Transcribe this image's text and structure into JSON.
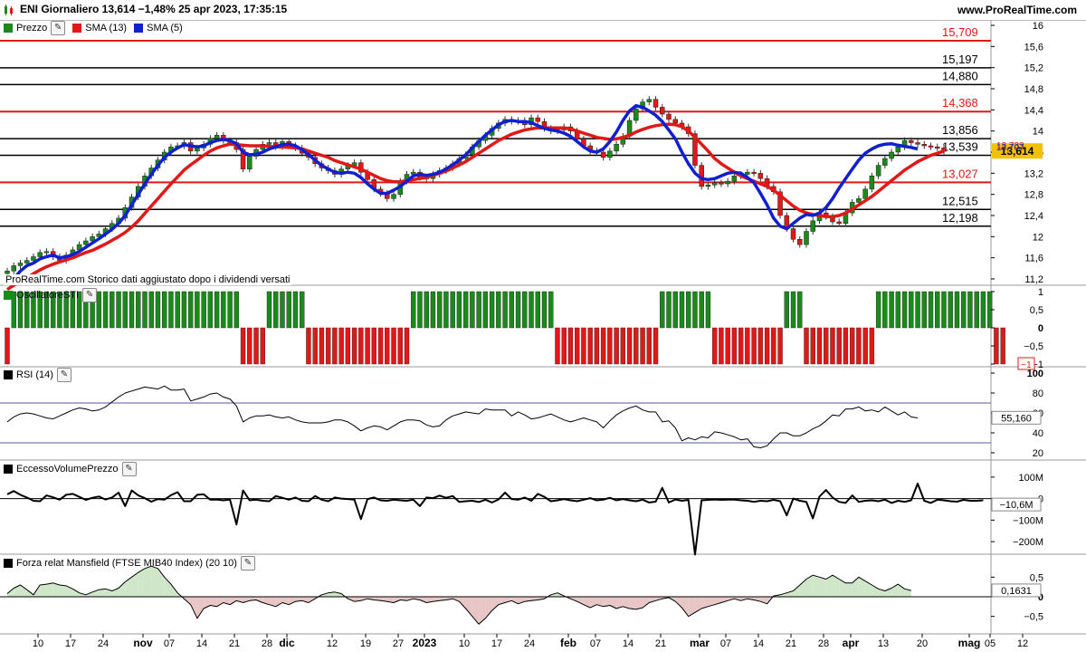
{
  "header": {
    "title": "ENI Giornaliero 13,614 −1,48% 25 apr 2023, 17:35:15",
    "brand": "www.ProRealTime.com"
  },
  "price_legend": {
    "price": "Prezzo",
    "sma13": "SMA (13)",
    "sma5": "SMA (5)"
  },
  "notice": "ProRealTime.com Storico dati aggiustato dopo i dividendi versati",
  "panels": {
    "sti": "OscillatoreSTI",
    "rsi": "RSI (14)",
    "volume": "EccessoVolumePrezzo",
    "mansfield": "Forza relat Mansfield (FTSE MIB40 Index) (20 10)"
  },
  "colors": {
    "up": "#1a8a1a",
    "down": "#e01818",
    "sma13": "#e01818",
    "sma5": "#1020d0",
    "price_tag": "#f2c200",
    "mans_pos": "#cfe6c8",
    "mans_neg": "#e8c6c6"
  },
  "chart_data": [
    {
      "type": "candlestick",
      "title": "ENI Giornaliero",
      "ylim": [
        11.2,
        16.0
      ],
      "yticks": [
        "16",
        "15,6",
        "15,2",
        "14,8",
        "14,4",
        "14",
        "13,6",
        "13,2",
        "12,8",
        "12,4",
        "12",
        "11,6",
        "11,2"
      ],
      "x_labels": [
        "10",
        "17",
        "24",
        "nov",
        "07",
        "14",
        "21",
        "28",
        "dic",
        "12",
        "19",
        "27",
        "2023",
        "10",
        "17",
        "24",
        "feb",
        "07",
        "14",
        "21",
        "mar",
        "07",
        "14",
        "21",
        "28",
        "apr",
        "13",
        "20",
        "mag",
        "05",
        "12"
      ],
      "last_price": "13,614",
      "last_change": "−1,48%",
      "price_axis_tags": [
        "13,707",
        "13,733"
      ],
      "levels": [
        {
          "label": "15,709",
          "value": 15.709,
          "color": "#e01818"
        },
        {
          "label": "15,197",
          "value": 15.197,
          "color": "#000000"
        },
        {
          "label": "14,880",
          "value": 14.88,
          "color": "#000000"
        },
        {
          "label": "14,368",
          "value": 14.368,
          "color": "#e01818"
        },
        {
          "label": "13,856",
          "value": 13.856,
          "color": "#000000"
        },
        {
          "label": "13,539",
          "value": 13.539,
          "color": "#000000"
        },
        {
          "label": "13,027",
          "value": 13.027,
          "color": "#e01818"
        },
        {
          "label": "12,515",
          "value": 12.515,
          "color": "#000000"
        },
        {
          "label": "12,198",
          "value": 12.198,
          "color": "#000000"
        }
      ],
      "close": [
        11.35,
        11.45,
        11.5,
        11.55,
        11.62,
        11.7,
        11.72,
        11.62,
        11.55,
        11.65,
        11.75,
        11.85,
        11.92,
        12.0,
        12.05,
        12.15,
        12.25,
        12.35,
        12.55,
        12.75,
        12.95,
        13.15,
        13.3,
        13.45,
        13.6,
        13.7,
        13.72,
        13.78,
        13.62,
        13.68,
        13.75,
        13.86,
        13.92,
        13.82,
        13.78,
        13.65,
        13.28,
        13.52,
        13.65,
        13.75,
        13.78,
        13.7,
        13.8,
        13.72,
        13.68,
        13.58,
        13.5,
        13.38,
        13.3,
        13.25,
        13.18,
        13.28,
        13.35,
        13.4,
        13.22,
        13.08,
        12.9,
        12.82,
        12.72,
        12.8,
        13.05,
        13.18,
        13.22,
        13.12,
        13.1,
        13.18,
        13.25,
        13.3,
        13.38,
        13.48,
        13.55,
        13.7,
        13.82,
        13.92,
        14.05,
        14.15,
        14.22,
        14.18,
        14.2,
        14.12,
        14.25,
        14.18,
        14.05,
        14.0,
        14.02,
        14.08,
        14.0,
        13.85,
        13.72,
        13.62,
        13.6,
        13.5,
        13.62,
        13.75,
        13.9,
        14.2,
        14.42,
        14.55,
        14.6,
        14.45,
        14.32,
        14.22,
        14.15,
        14.08,
        13.95,
        13.35,
        12.95,
        12.98,
        13.02,
        13.0,
        13.05,
        13.15,
        13.18,
        13.22,
        13.2,
        13.1,
        12.95,
        12.85,
        12.4,
        12.15,
        11.95,
        11.85,
        12.1,
        12.3,
        12.45,
        12.38,
        12.28,
        12.25,
        12.45,
        12.65,
        12.72,
        12.9,
        13.15,
        13.35,
        13.48,
        13.6,
        13.7,
        13.82,
        13.78,
        13.75,
        13.72,
        13.7,
        13.68,
        13.614
      ],
      "sma13": [
        11.0,
        11.08,
        11.15,
        11.22,
        11.3,
        11.37,
        11.43,
        11.48,
        11.52,
        11.56,
        11.6,
        11.65,
        11.7,
        11.74,
        11.8,
        11.86,
        11.93,
        12.0,
        12.08,
        12.18,
        12.3,
        12.44,
        12.58,
        12.72,
        12.86,
        13.0,
        13.13,
        13.26,
        13.36,
        13.45,
        13.54,
        13.62,
        13.68,
        13.72,
        13.75,
        13.74,
        13.73,
        13.72,
        13.72,
        13.72,
        13.71,
        13.7,
        13.7,
        13.69,
        13.68,
        13.66,
        13.62,
        13.58,
        13.54,
        13.5,
        13.44,
        13.4,
        13.36,
        13.32,
        13.28,
        13.22,
        13.16,
        13.1,
        13.06,
        13.04,
        13.04,
        13.06,
        13.08,
        13.1,
        13.12,
        13.16,
        13.2,
        13.24,
        13.3,
        13.36,
        13.42,
        13.5,
        13.58,
        13.66,
        13.74,
        13.82,
        13.88,
        13.94,
        13.98,
        14.02,
        14.04,
        14.06,
        14.06,
        14.06,
        14.06,
        14.06,
        14.04,
        14.0,
        13.96,
        13.92,
        13.88,
        13.86,
        13.84,
        13.85,
        13.88,
        13.92,
        13.98,
        14.03,
        14.07,
        14.1,
        14.12,
        14.13,
        14.12,
        14.08,
        14.0,
        13.88,
        13.75,
        13.62,
        13.48,
        13.38,
        13.3,
        13.22,
        13.15,
        13.1,
        13.05,
        13.0,
        12.95,
        12.88,
        12.78,
        12.68,
        12.58,
        12.5,
        12.45,
        12.42,
        12.4,
        12.38,
        12.38,
        12.4,
        12.45,
        12.52,
        12.6,
        12.68,
        12.76,
        12.86,
        12.96,
        13.06,
        13.16,
        13.26,
        13.34,
        13.42,
        13.48,
        13.54,
        13.58,
        13.62
      ],
      "sma5": [
        11.1,
        11.2,
        11.35,
        11.45,
        11.5,
        11.58,
        11.62,
        11.65,
        11.6,
        11.62,
        11.66,
        11.72,
        11.8,
        11.88,
        11.96,
        12.05,
        12.14,
        12.25,
        12.4,
        12.6,
        12.8,
        13.0,
        13.18,
        13.35,
        13.5,
        13.6,
        13.68,
        13.74,
        13.72,
        13.7,
        13.72,
        13.78,
        13.82,
        13.84,
        13.82,
        13.76,
        13.6,
        13.55,
        13.56,
        13.6,
        13.66,
        13.7,
        13.74,
        13.75,
        13.72,
        13.65,
        13.55,
        13.45,
        13.35,
        13.28,
        13.22,
        13.2,
        13.22,
        13.2,
        13.12,
        13.0,
        12.9,
        12.82,
        12.82,
        12.88,
        12.95,
        13.05,
        13.15,
        13.18,
        13.16,
        13.18,
        13.22,
        13.28,
        13.36,
        13.45,
        13.55,
        13.68,
        13.8,
        13.92,
        14.02,
        14.12,
        14.18,
        14.2,
        14.18,
        14.18,
        14.16,
        14.1,
        14.05,
        14.02,
        14.0,
        13.96,
        13.9,
        13.8,
        13.7,
        13.62,
        13.6,
        13.66,
        13.8,
        13.98,
        14.2,
        14.38,
        14.48,
        14.45,
        14.38,
        14.3,
        14.18,
        14.02,
        13.85,
        13.6,
        13.38,
        13.2,
        13.1,
        13.08,
        13.1,
        13.15,
        13.2,
        13.22,
        13.2,
        13.12,
        13.02,
        12.82,
        12.6,
        12.35,
        12.2,
        12.15,
        12.25,
        12.35,
        12.42,
        12.4,
        12.45,
        12.55,
        12.72,
        12.92,
        13.1,
        13.28,
        13.45,
        13.58,
        13.66,
        13.72,
        13.75,
        13.76,
        13.73,
        13.71,
        13.69,
        13.66
      ]
    },
    {
      "type": "bar",
      "title": "OscillatoreSTI",
      "ylim": [
        -1,
        1
      ],
      "yticks": [
        "1",
        "0,5",
        "0",
        "−0,5",
        "−1"
      ],
      "last_value": "−1",
      "values": [
        -1,
        1,
        1,
        1,
        1,
        1,
        1,
        1,
        1,
        1,
        1,
        1,
        1,
        1,
        1,
        1,
        1,
        1,
        1,
        1,
        1,
        1,
        1,
        1,
        1,
        1,
        1,
        1,
        1,
        1,
        1,
        1,
        1,
        1,
        1,
        1,
        -1,
        -1,
        -1,
        -1,
        1,
        1,
        1,
        1,
        1,
        1,
        -1,
        -1,
        -1,
        -1,
        -1,
        -1,
        -1,
        -1,
        -1,
        -1,
        -1,
        -1,
        -1,
        -1,
        -1,
        -1,
        1,
        1,
        1,
        1,
        1,
        1,
        1,
        1,
        1,
        1,
        1,
        1,
        1,
        1,
        1,
        1,
        1,
        1,
        1,
        1,
        1,
        1,
        -1,
        -1,
        -1,
        -1,
        -1,
        -1,
        -1,
        -1,
        -1,
        -1,
        -1,
        -1,
        -1,
        -1,
        -1,
        -1,
        1,
        1,
        1,
        1,
        1,
        1,
        1,
        1,
        -1,
        -1,
        -1,
        -1,
        -1,
        -1,
        -1,
        -1,
        -1,
        -1,
        -1,
        1,
        1,
        1,
        -1,
        -1,
        -1,
        -1,
        -1,
        -1,
        -1,
        -1,
        -1,
        -1,
        -1,
        1,
        1,
        1,
        1,
        1,
        1,
        1,
        1,
        1,
        1,
        1,
        1,
        1,
        1,
        1,
        1,
        1,
        1,
        -1,
        -1
      ]
    },
    {
      "type": "line",
      "title": "RSI (14)",
      "ylim": [
        20,
        100
      ],
      "yticks": [
        "100",
        "80",
        "60",
        "40",
        "20"
      ],
      "levels": [
        70,
        30
      ],
      "last_value": "55,160",
      "values": [
        51,
        56,
        59,
        60,
        59,
        57,
        55,
        54,
        57,
        60,
        63,
        65,
        64,
        62,
        63,
        66,
        71,
        76,
        80,
        82,
        84,
        86,
        85,
        84,
        87,
        83,
        83,
        84,
        72,
        74,
        76,
        79,
        80,
        76,
        74,
        67,
        51,
        55,
        57,
        57,
        58,
        56,
        55,
        56,
        53,
        51,
        50,
        50,
        50,
        51,
        53,
        53,
        51,
        47,
        42,
        45,
        47,
        46,
        43,
        47,
        51,
        53,
        53,
        52,
        48,
        46,
        47,
        53,
        57,
        59,
        61,
        60,
        59,
        64,
        63,
        63,
        63,
        57,
        61,
        58,
        54,
        55,
        57,
        59,
        56,
        53,
        51,
        53,
        55,
        53,
        51,
        45,
        52,
        58,
        62,
        65,
        67,
        63,
        61,
        61,
        51,
        52,
        45,
        32,
        35,
        33,
        36,
        35,
        41,
        40,
        38,
        36,
        33,
        34,
        26,
        25,
        27,
        34,
        40,
        40,
        37,
        37,
        40,
        44,
        47,
        52,
        58,
        57,
        64,
        64,
        66,
        62,
        63,
        61,
        66,
        62,
        58,
        61,
        56,
        55
      ]
    },
    {
      "type": "line",
      "title": "EccessoVolumePrezzo",
      "ylim": [
        -250,
        150
      ],
      "yticks": [
        "100M",
        "0",
        "−100M",
        "−200M"
      ],
      "last_value": "−10,6M",
      "values": [
        20,
        35,
        18,
        5,
        -10,
        -12,
        15,
        6,
        -5,
        18,
        22,
        8,
        -6,
        4,
        10,
        -4,
        5,
        28,
        -35,
        38,
        15,
        2,
        -14,
        -2,
        -5,
        16,
        30,
        -12,
        -12,
        18,
        20,
        -5,
        -4,
        -8,
        -4,
        -120,
        38,
        -8,
        -5,
        -10,
        -12,
        12,
        4,
        -5,
        5,
        -10,
        -12,
        12,
        -5,
        -12,
        5,
        0,
        -2,
        -5,
        -95,
        -2,
        5,
        -8,
        -10,
        -5,
        -8,
        -10,
        -5,
        -35,
        5,
        2,
        14,
        4,
        12,
        -15,
        -12,
        -10,
        -16,
        -5,
        -18,
        -4,
        28,
        -2,
        -5,
        5,
        -10,
        22,
        8,
        -12,
        -8,
        -2,
        -8,
        -12,
        -5,
        2,
        -8,
        -5,
        4,
        -8,
        -2,
        -8,
        -12,
        -5,
        -18,
        -14,
        50,
        -18,
        -4,
        -10,
        -6,
        -260,
        -8,
        -6,
        -4,
        -6,
        -5,
        -5,
        -8,
        -10,
        -15,
        -10,
        -12,
        -6,
        -12,
        -78,
        0,
        -10,
        -15,
        -92,
        10,
        40,
        5,
        -15,
        -20,
        15,
        -15,
        -10,
        -8,
        -12,
        -5,
        -20,
        -10,
        -15,
        -8,
        70,
        -10,
        -20,
        -5,
        -8,
        -12,
        -14,
        -6,
        -10,
        -10,
        -8
      ]
    },
    {
      "type": "area",
      "title": "Forza relat Mansfield (FTSE MIB40 Index) (20 10)",
      "ylim": [
        -0.9,
        0.9
      ],
      "yticks": [
        "0,5",
        "0",
        "−0,5"
      ],
      "last_value": "0,1631",
      "values": [
        0.08,
        0.22,
        0.3,
        0.18,
        0.05,
        0.3,
        0.32,
        0.35,
        0.3,
        0.28,
        0.2,
        0.1,
        0.05,
        0.12,
        0.18,
        0.2,
        0.15,
        0.22,
        0.38,
        0.5,
        0.62,
        0.72,
        0.78,
        0.72,
        0.5,
        0.32,
        0.1,
        -0.05,
        -0.2,
        -0.55,
        -0.3,
        -0.22,
        -0.25,
        -0.15,
        -0.2,
        -0.1,
        -0.15,
        -0.1,
        -0.08,
        -0.15,
        -0.2,
        -0.25,
        -0.15,
        -0.2,
        -0.12,
        -0.1,
        -0.15,
        -0.05,
        0.05,
        0.1,
        0.12,
        0.08,
        -0.05,
        -0.12,
        -0.1,
        -0.05,
        -0.08,
        -0.1,
        -0.12,
        -0.15,
        -0.08,
        -0.1,
        -0.05,
        -0.08,
        -0.15,
        -0.12,
        -0.1,
        -0.08,
        -0.05,
        -0.12,
        -0.3,
        -0.5,
        -0.7,
        -0.55,
        -0.35,
        -0.2,
        -0.15,
        -0.1,
        -0.18,
        -0.12,
        -0.1,
        -0.08,
        -0.05,
        0.05,
        0.1,
        0.02,
        -0.05,
        -0.12,
        -0.2,
        -0.28,
        -0.2,
        -0.25,
        -0.22,
        -0.3,
        -0.25,
        -0.3,
        -0.32,
        -0.28,
        -0.15,
        -0.1,
        -0.05,
        -0.02,
        -0.12,
        -0.28,
        -0.5,
        -0.4,
        -0.3,
        -0.25,
        -0.2,
        -0.15,
        -0.1,
        -0.05,
        -0.1,
        -0.05,
        -0.08,
        -0.12,
        -0.18,
        0.02,
        0.05,
        0.1,
        0.15,
        0.3,
        0.45,
        0.55,
        0.5,
        0.45,
        0.55,
        0.45,
        0.35,
        0.35,
        0.5,
        0.4,
        0.3,
        0.2,
        0.15,
        0.22,
        0.32,
        0.2,
        0.16
      ]
    }
  ]
}
